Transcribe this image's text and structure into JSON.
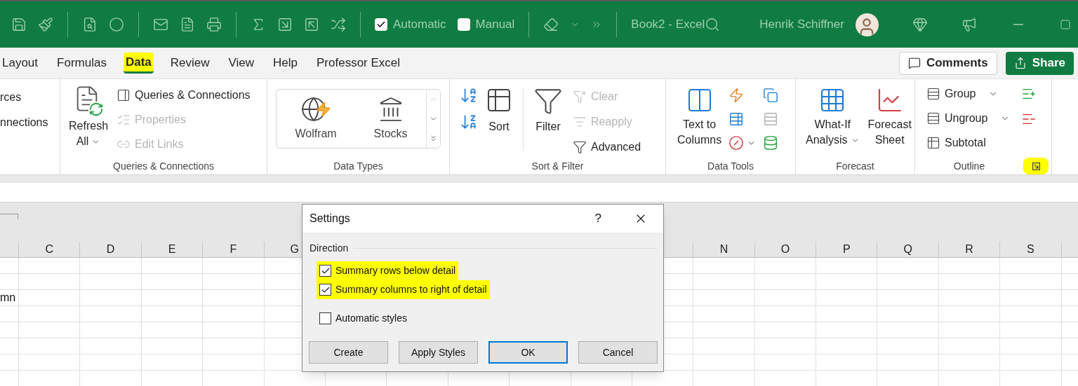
{
  "window": {
    "title": "Book2 - Excel",
    "user": "Henrik Schiffner"
  },
  "quick_access": [
    {
      "kind": "checkbox",
      "label": "Automatic",
      "checked": true
    },
    {
      "kind": "checkbox",
      "label": "Manual",
      "checked": false
    }
  ],
  "tabs": [
    {
      "label": "Layout",
      "selected": false,
      "highlighted": false
    },
    {
      "label": "Formulas",
      "selected": false,
      "highlighted": false
    },
    {
      "label": "Data",
      "selected": true,
      "highlighted": true
    },
    {
      "label": "Review",
      "selected": false,
      "highlighted": false
    },
    {
      "label": "View",
      "selected": false,
      "highlighted": false
    },
    {
      "label": "Help",
      "selected": false,
      "highlighted": false
    },
    {
      "label": "Professor Excel",
      "selected": false,
      "highlighted": false
    }
  ],
  "header_buttons": [
    {
      "kind": "comments",
      "label": "Comments"
    },
    {
      "kind": "share",
      "label": "Share"
    }
  ],
  "ribbon": {
    "groups": [
      {
        "kind": "clipped",
        "items": [
          {
            "label": "rces"
          },
          {
            "label": "nnections"
          }
        ]
      },
      {
        "kind": "queries",
        "label": "Queries & Connections",
        "large": {
          "lines": [
            "Refresh",
            "All"
          ],
          "dropdown": true
        },
        "items": [
          {
            "label": "Queries & Connections",
            "disabled": false
          },
          {
            "label": "Properties",
            "disabled": true
          },
          {
            "label": "Edit Links",
            "disabled": true
          }
        ]
      },
      {
        "kind": "gallery",
        "label": "Data Types",
        "items": [
          {
            "label": "Wolfram"
          },
          {
            "label": "Stocks"
          }
        ]
      },
      {
        "kind": "sort_filter",
        "label": "Sort & Filter",
        "buttons": [
          {
            "label": "Sort"
          },
          {
            "label": "Filter"
          }
        ],
        "items": [
          {
            "label": "Clear",
            "disabled": true
          },
          {
            "label": "Reapply",
            "disabled": true
          },
          {
            "label": "Advanced",
            "disabled": false
          }
        ]
      },
      {
        "kind": "data_tools",
        "label": "Data Tools",
        "large": {
          "lines": [
            "Text to",
            "Columns"
          ]
        }
      },
      {
        "kind": "forecast",
        "label": "Forecast",
        "buttons": [
          {
            "lines": [
              "What-If",
              "Analysis"
            ],
            "dropdown": true
          },
          {
            "lines": [
              "Forecast",
              "Sheet"
            ],
            "dropdown": false
          }
        ]
      },
      {
        "kind": "outline",
        "label": "Outline",
        "items": [
          {
            "label": "Group",
            "dropdown": true
          },
          {
            "label": "Ungroup",
            "dropdown": true
          },
          {
            "label": "Subtotal",
            "dropdown": false
          }
        ],
        "launcher_highlighted": true
      }
    ]
  },
  "sheet": {
    "columns_left": [
      "C",
      "D",
      "E",
      "F",
      "G"
    ],
    "columns_right": [
      "N",
      "O",
      "P",
      "Q",
      "R",
      "S"
    ],
    "clipped_text": "mn"
  },
  "dialog": {
    "title": "Settings",
    "help": "?",
    "section": "Direction",
    "options": [
      {
        "label": "Summary rows below detail",
        "checked": true,
        "highlighted": true
      },
      {
        "label": "Summary columns to right of detail",
        "checked": true,
        "highlighted": true
      },
      {
        "label": "Automatic styles",
        "checked": false,
        "highlighted": false
      }
    ],
    "buttons": [
      {
        "label": "Create",
        "selected": false
      },
      {
        "label": "Apply Styles",
        "selected": false
      },
      {
        "label": "OK",
        "selected": true
      },
      {
        "label": "Cancel",
        "selected": false
      }
    ]
  }
}
